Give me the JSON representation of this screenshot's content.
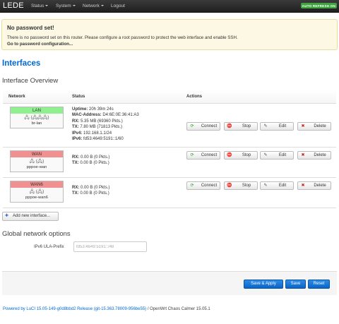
{
  "navbar": {
    "brand": "LEDE",
    "menu": [
      {
        "label": "Status",
        "dropdown": true
      },
      {
        "label": "System",
        "dropdown": true
      },
      {
        "label": "Network",
        "dropdown": true
      },
      {
        "label": "Logout",
        "dropdown": false
      }
    ],
    "auto_refresh": "AUTO REFRESH ON"
  },
  "alert": {
    "title": "No password set!",
    "message": "There is no password set on this router. Please configure a root password to protect the web interface and enable SSH.",
    "link": "Go to password configuration..."
  },
  "page_title": "Interfaces",
  "overview_title": "Interface Overview",
  "table": {
    "headers": {
      "network": "Network",
      "status": "Status",
      "actions": "Actions"
    },
    "rows": [
      {
        "name": "LAN",
        "zone_color": "#90f090",
        "icons": "🖧 (🖧🖧🖧)",
        "device": "br-lan",
        "status": [
          {
            "label": "Uptime:",
            "value": " 20h 39m 24s"
          },
          {
            "label": "MAC-Address:",
            "value": " D4:6E:0E:36:41:A3"
          },
          {
            "label": "RX:",
            "value": " 5.35 MB (69360 Pkts.)"
          },
          {
            "label": "TX:",
            "value": " 7.80 MB (71813 Pkts.)"
          },
          {
            "label": "IPv4:",
            "value": " 192.168.1.1/24"
          },
          {
            "label": "IPv6:",
            "value": " fd53:4649:5191::1/60"
          }
        ]
      },
      {
        "name": "WAN",
        "zone_color": "#f09090",
        "icons": "🖧 (🖧)",
        "device": "pppoe-wan",
        "status": [
          {
            "label": "RX:",
            "value": " 0.00 B (0 Pkts.)"
          },
          {
            "label": "TX:",
            "value": " 0.00 B (0 Pkts.)"
          }
        ]
      },
      {
        "name": "WAN6",
        "zone_color": "#f09090",
        "icons": "🖧 (🖧)",
        "device": "pppoe-wan6",
        "status": [
          {
            "label": "RX:",
            "value": " 0.00 B (0 Pkts.)"
          },
          {
            "label": "TX:",
            "value": " 0.00 B (0 Pkts.)"
          }
        ]
      }
    ],
    "buttons": {
      "connect": "Connect",
      "stop": "Stop",
      "edit": "Edit",
      "delete": "Delete"
    }
  },
  "add_interface": "Add new interface...",
  "global_title": "Global network options",
  "ula": {
    "label": "IPv6 ULA-Prefix",
    "value": "fd53:4649:5191::/48"
  },
  "actions": {
    "save_apply": "Save & Apply",
    "save": "Save",
    "reset": "Reset"
  },
  "footer": {
    "link": "Powered by LuCI 15.05-149-g0d8bbd2 Release (git-15.363.78009-956be55)",
    "text": " / OpenWrt Chaos Calmer 15.05.1"
  }
}
